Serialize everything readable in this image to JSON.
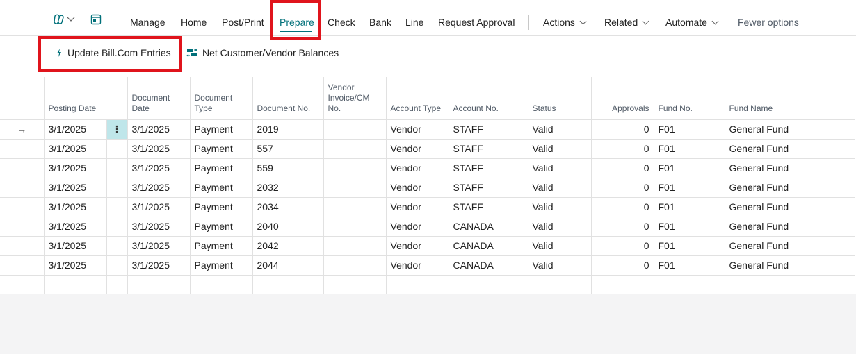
{
  "actionbar": {
    "icons": [
      "copilot-icon",
      "chevron-down-icon",
      "page-layout-icon"
    ],
    "items": [
      {
        "label": "Manage"
      },
      {
        "label": "Home"
      },
      {
        "label": "Post/Print"
      },
      {
        "label": "Prepare",
        "active": true
      },
      {
        "label": "Check"
      },
      {
        "label": "Bank"
      },
      {
        "label": "Line"
      },
      {
        "label": "Request Approval"
      }
    ],
    "menus": [
      {
        "label": "Actions"
      },
      {
        "label": "Related"
      },
      {
        "label": "Automate"
      }
    ],
    "fewer_options": "Fewer options"
  },
  "subbar": {
    "update_billcom": "Update Bill.Com Entries",
    "net_balances": "Net Customer/Vendor Balances"
  },
  "table": {
    "headers": {
      "posting_date": "Posting Date",
      "document_date": "Document Date",
      "document_type": "Document Type",
      "document_no": "Document No.",
      "vendor_invoice": "Vendor Invoice/CM No.",
      "account_type": "Account Type",
      "account_no": "Account No.",
      "status": "Status",
      "approvals": "Approvals",
      "fund_no": "Fund No.",
      "fund_name": "Fund Name"
    },
    "rows": [
      {
        "posting_date": "3/1/2025",
        "document_date": "3/1/2025",
        "document_type": "Payment",
        "document_no": "2019",
        "vendor_invoice": "",
        "account_type": "Vendor",
        "account_no": "STAFF",
        "status": "Valid",
        "approvals": "0",
        "fund_no": "F01",
        "fund_name": "General Fund"
      },
      {
        "posting_date": "3/1/2025",
        "document_date": "3/1/2025",
        "document_type": "Payment",
        "document_no": "557",
        "vendor_invoice": "",
        "account_type": "Vendor",
        "account_no": "STAFF",
        "status": "Valid",
        "approvals": "0",
        "fund_no": "F01",
        "fund_name": "General Fund"
      },
      {
        "posting_date": "3/1/2025",
        "document_date": "3/1/2025",
        "document_type": "Payment",
        "document_no": "559",
        "vendor_invoice": "",
        "account_type": "Vendor",
        "account_no": "STAFF",
        "status": "Valid",
        "approvals": "0",
        "fund_no": "F01",
        "fund_name": "General Fund"
      },
      {
        "posting_date": "3/1/2025",
        "document_date": "3/1/2025",
        "document_type": "Payment",
        "document_no": "2032",
        "vendor_invoice": "",
        "account_type": "Vendor",
        "account_no": "STAFF",
        "status": "Valid",
        "approvals": "0",
        "fund_no": "F01",
        "fund_name": "General Fund"
      },
      {
        "posting_date": "3/1/2025",
        "document_date": "3/1/2025",
        "document_type": "Payment",
        "document_no": "2034",
        "vendor_invoice": "",
        "account_type": "Vendor",
        "account_no": "STAFF",
        "status": "Valid",
        "approvals": "0",
        "fund_no": "F01",
        "fund_name": "General Fund"
      },
      {
        "posting_date": "3/1/2025",
        "document_date": "3/1/2025",
        "document_type": "Payment",
        "document_no": "2040",
        "vendor_invoice": "",
        "account_type": "Vendor",
        "account_no": "CANADA",
        "status": "Valid",
        "approvals": "0",
        "fund_no": "F01",
        "fund_name": "General Fund"
      },
      {
        "posting_date": "3/1/2025",
        "document_date": "3/1/2025",
        "document_type": "Payment",
        "document_no": "2042",
        "vendor_invoice": "",
        "account_type": "Vendor",
        "account_no": "CANADA",
        "status": "Valid",
        "approvals": "0",
        "fund_no": "F01",
        "fund_name": "General Fund"
      },
      {
        "posting_date": "3/1/2025",
        "document_date": "3/1/2025",
        "document_type": "Payment",
        "document_no": "2044",
        "vendor_invoice": "",
        "account_type": "Vendor",
        "account_no": "CANADA",
        "status": "Valid",
        "approvals": "0",
        "fund_no": "F01",
        "fund_name": "General Fund"
      }
    ],
    "current_row_marker": "→",
    "row_menu_glyph": "⋮"
  },
  "colors": {
    "accent": "#00707a",
    "highlight_box": "#e0141c",
    "selected_cell": "#bfe6ea",
    "footer_bg": "#f4f4f5"
  }
}
